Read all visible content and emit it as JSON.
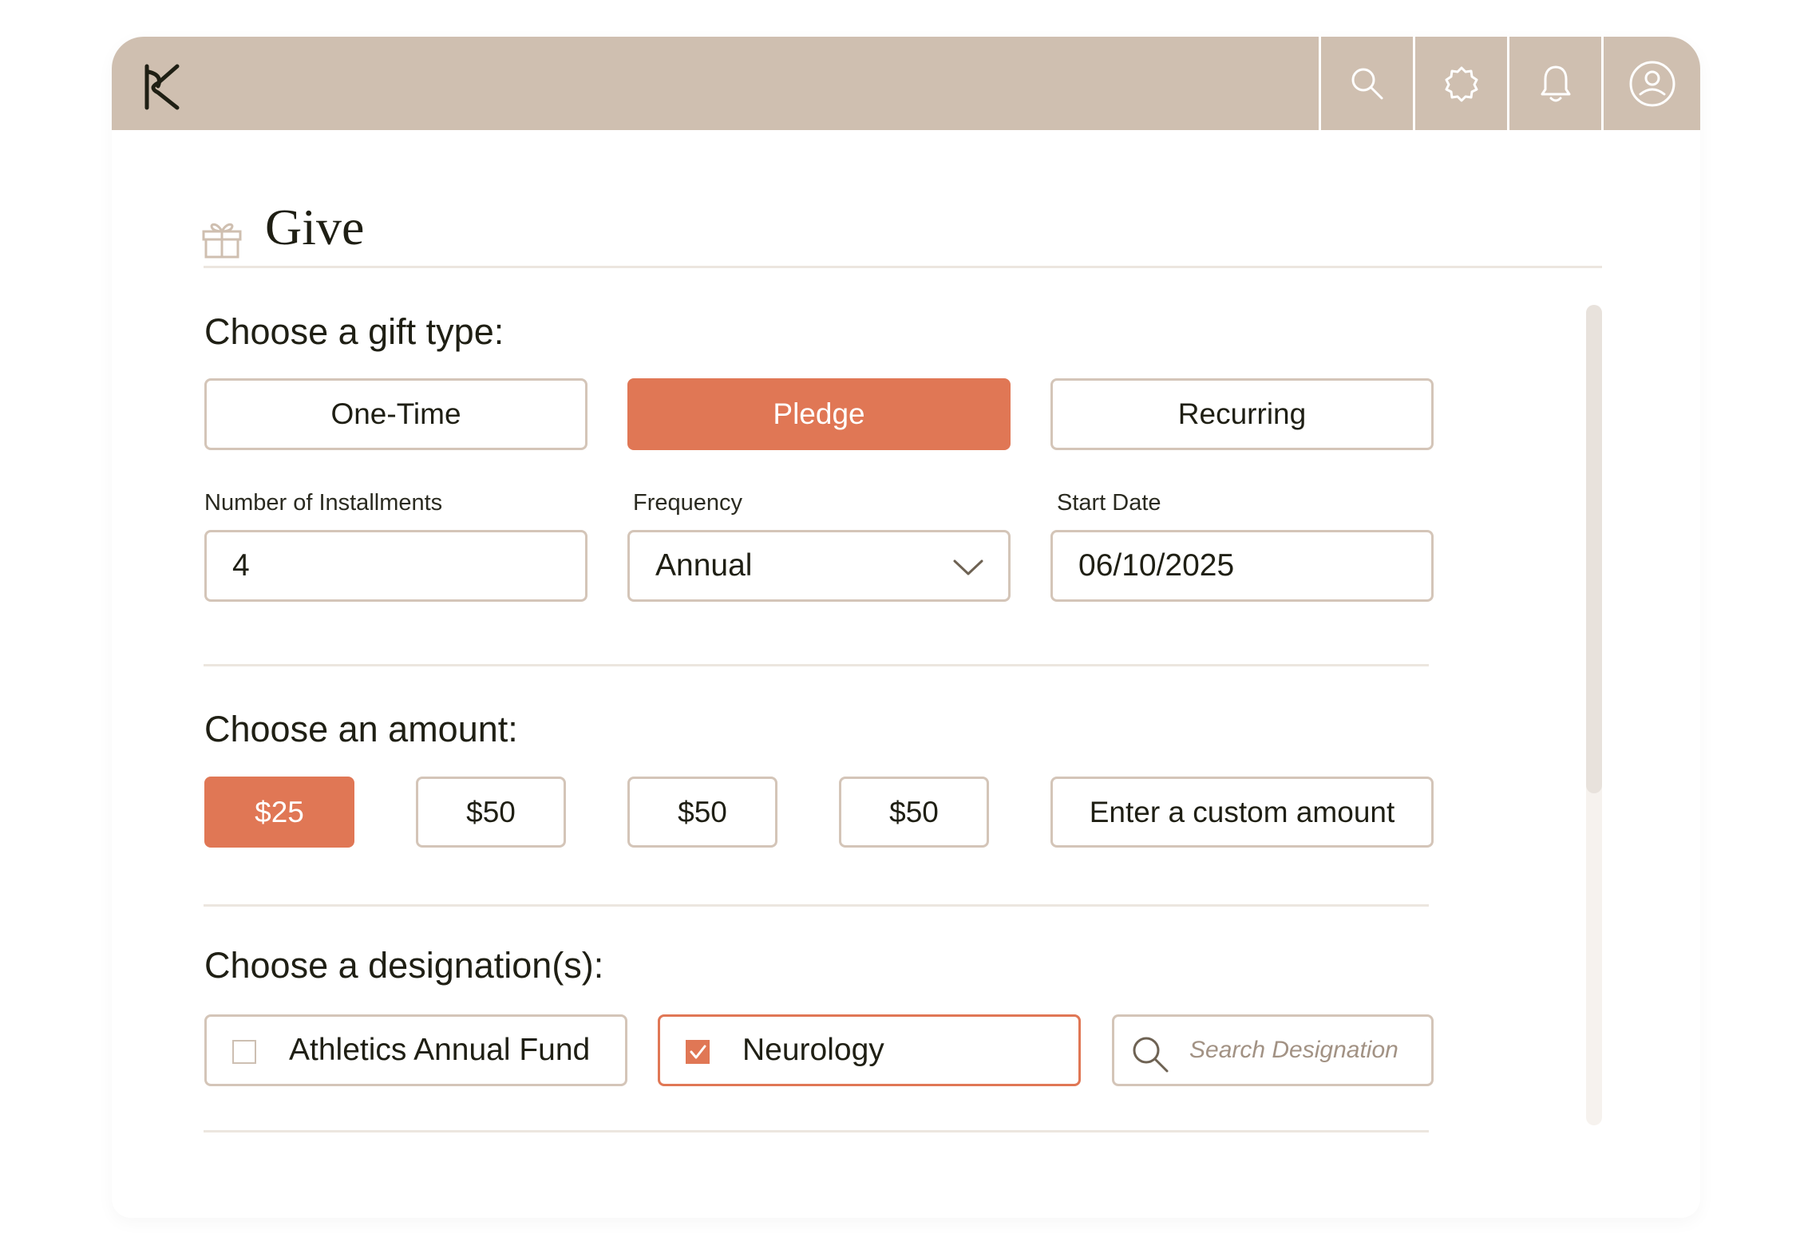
{
  "app": {
    "logo_icon": "k-logo-icon",
    "header_icons": [
      "search-icon",
      "gear-icon",
      "bell-icon",
      "user-avatar-icon"
    ],
    "colors": {
      "header": "#cfbfb0",
      "accent": "#e07755",
      "border": "#d4c5b8"
    }
  },
  "page": {
    "title": "Give",
    "icon": "gift-icon"
  },
  "gift_type": {
    "heading": "Choose a gift type:",
    "options": [
      {
        "label": "One-Time",
        "selected": false
      },
      {
        "label": "Pledge",
        "selected": true
      },
      {
        "label": "Recurring",
        "selected": false
      }
    ]
  },
  "pledge": {
    "installments": {
      "label": "Number of Installments",
      "value": "4"
    },
    "frequency": {
      "label": "Frequency",
      "value": "Annual"
    },
    "start_date": {
      "label": "Start Date",
      "value": "06/10/2025"
    }
  },
  "amount": {
    "heading": "Choose an amount:",
    "options": [
      {
        "label": "$25",
        "selected": true
      },
      {
        "label": "$50",
        "selected": false
      },
      {
        "label": "$50",
        "selected": false
      },
      {
        "label": "$50",
        "selected": false
      }
    ],
    "custom_label": "Enter a custom amount"
  },
  "designation": {
    "heading": "Choose a designation(s):",
    "options": [
      {
        "label": "Athletics Annual Fund",
        "checked": false
      },
      {
        "label": "Neurology",
        "checked": true
      }
    ],
    "search_placeholder": "Search Designation"
  }
}
